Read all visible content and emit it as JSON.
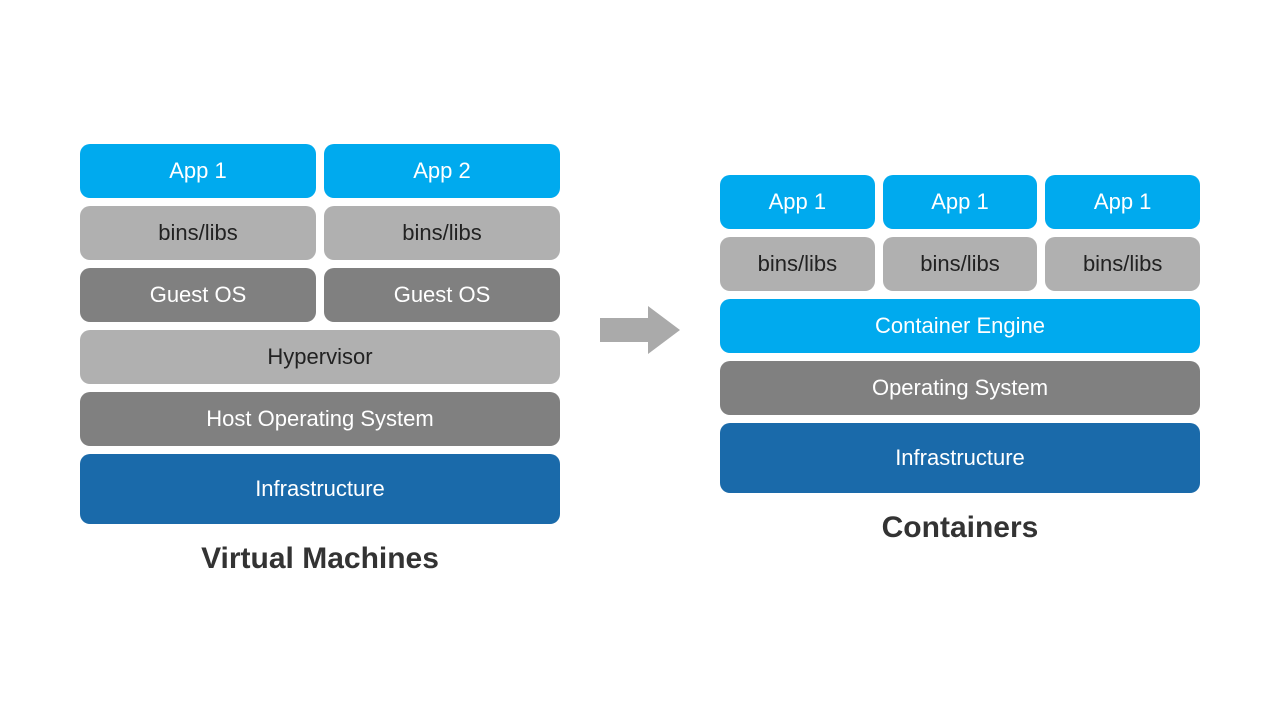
{
  "left": {
    "title": "Virtual Machines",
    "rows": {
      "apps": [
        "App 1",
        "App 2"
      ],
      "bins": [
        "bins/libs",
        "bins/libs"
      ],
      "guestos": [
        "Guest OS",
        "Guest OS"
      ],
      "hypervisor": "Hypervisor",
      "hostos": "Host Operating System",
      "infra": "Infrastructure"
    }
  },
  "right": {
    "title": "Containers",
    "rows": {
      "apps": [
        "App 1",
        "App 1",
        "App 1"
      ],
      "bins": [
        "bins/libs",
        "bins/libs",
        "bins/libs"
      ],
      "engine": "Container Engine",
      "os": "Operating System",
      "infra": "Infrastructure"
    }
  }
}
